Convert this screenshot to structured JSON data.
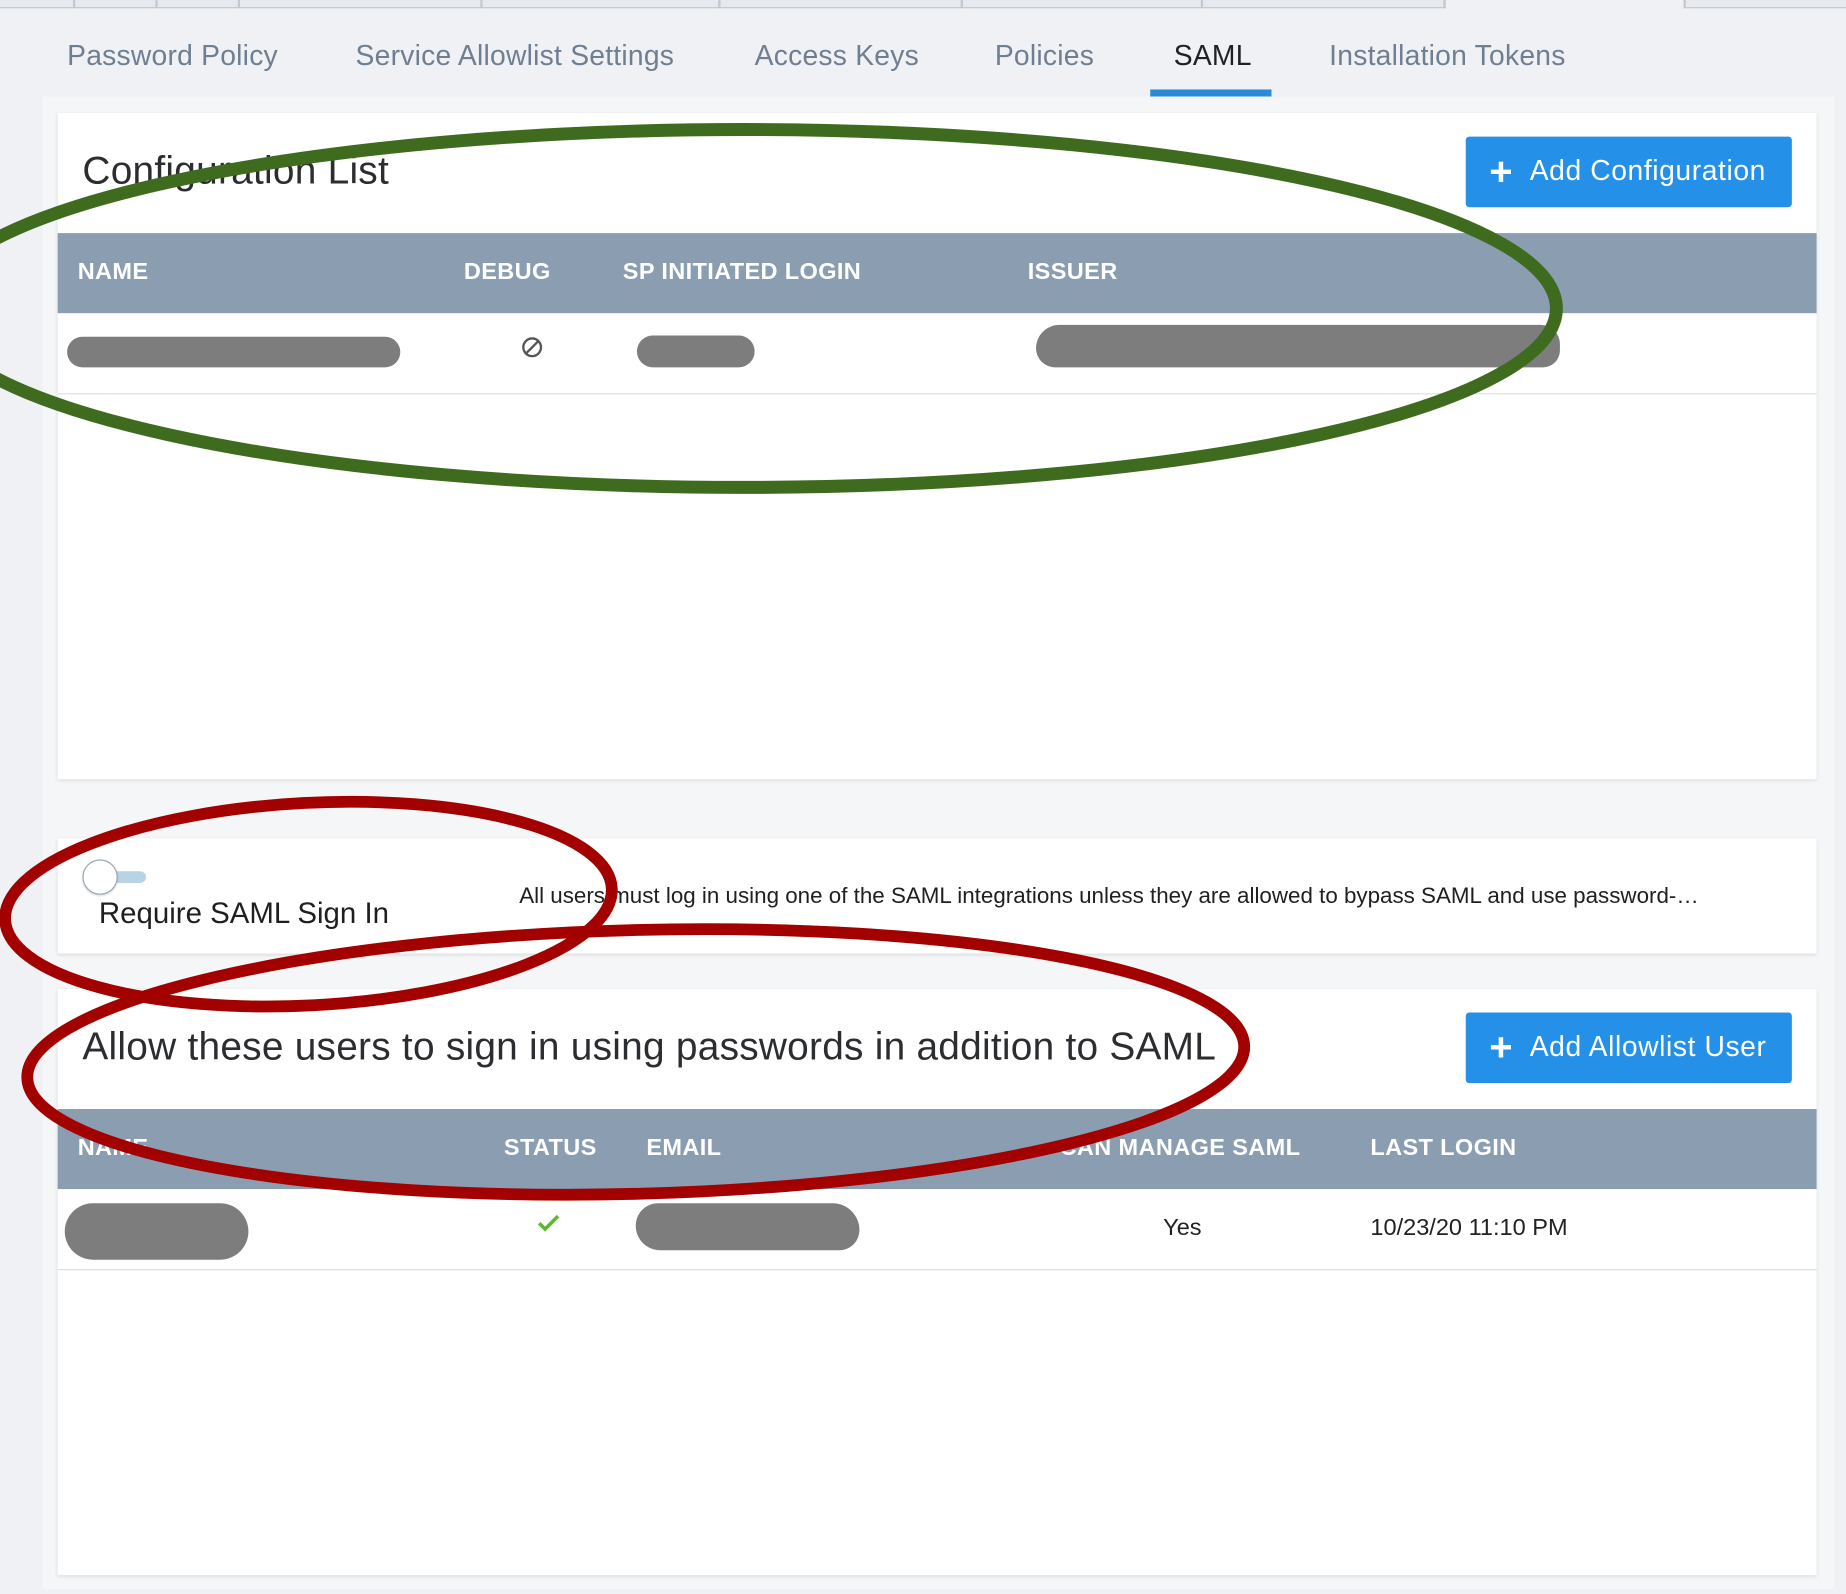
{
  "tabs": [
    {
      "label": "Password Policy",
      "active": false
    },
    {
      "label": "Service Allowlist Settings",
      "active": false
    },
    {
      "label": "Access Keys",
      "active": false
    },
    {
      "label": "Policies",
      "active": false
    },
    {
      "label": "SAML",
      "active": true
    },
    {
      "label": "Installation Tokens",
      "active": false
    }
  ],
  "config_section": {
    "title": "Configuration List",
    "add_button_label": "Add Configuration",
    "columns": [
      "NAME",
      "DEBUG",
      "SP INITIATED LOGIN",
      "ISSUER"
    ],
    "rows": [
      {
        "name": "",
        "debug_icon": "disabled-icon",
        "sp_initiated_login": "",
        "issuer": ""
      }
    ]
  },
  "require_saml": {
    "label": "Require SAML Sign In",
    "enabled": false,
    "description": "All users must log in using one of the SAML integrations unless they are allowed to bypass SAML and use password-…"
  },
  "allowlist_section": {
    "title": "Allow these users to sign in using passwords in addition to SAML",
    "add_button_label": "Add Allowlist User",
    "columns": [
      "NAME",
      "STATUS",
      "EMAIL",
      "CAN MANAGE SAML",
      "LAST LOGIN"
    ],
    "rows": [
      {
        "name": "",
        "status_icon": "check-icon",
        "email": "",
        "can_manage_saml": "Yes",
        "last_login": "10/23/20 11:10 PM"
      }
    ]
  },
  "colors": {
    "accent": "#2590e8",
    "table_header": "#8a9db1",
    "annotation_green": "#3f6b1f",
    "annotation_red": "#a30000"
  }
}
